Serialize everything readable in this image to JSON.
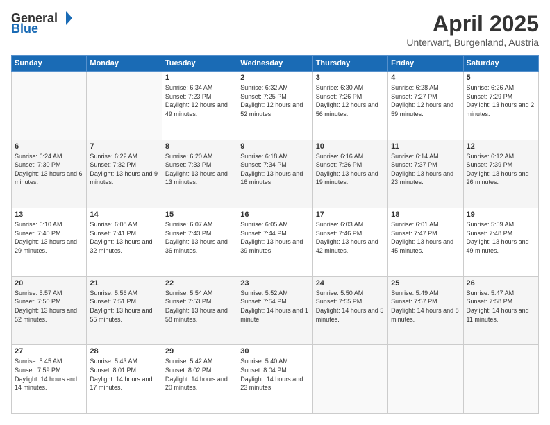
{
  "header": {
    "logo_general": "General",
    "logo_blue": "Blue",
    "month": "April 2025",
    "location": "Unterwart, Burgenland, Austria"
  },
  "days_of_week": [
    "Sunday",
    "Monday",
    "Tuesday",
    "Wednesday",
    "Thursday",
    "Friday",
    "Saturday"
  ],
  "weeks": [
    [
      {
        "day": "",
        "empty": true
      },
      {
        "day": "",
        "empty": true
      },
      {
        "day": "1",
        "sunrise": "Sunrise: 6:34 AM",
        "sunset": "Sunset: 7:23 PM",
        "daylight": "Daylight: 12 hours and 49 minutes."
      },
      {
        "day": "2",
        "sunrise": "Sunrise: 6:32 AM",
        "sunset": "Sunset: 7:25 PM",
        "daylight": "Daylight: 12 hours and 52 minutes."
      },
      {
        "day": "3",
        "sunrise": "Sunrise: 6:30 AM",
        "sunset": "Sunset: 7:26 PM",
        "daylight": "Daylight: 12 hours and 56 minutes."
      },
      {
        "day": "4",
        "sunrise": "Sunrise: 6:28 AM",
        "sunset": "Sunset: 7:27 PM",
        "daylight": "Daylight: 12 hours and 59 minutes."
      },
      {
        "day": "5",
        "sunrise": "Sunrise: 6:26 AM",
        "sunset": "Sunset: 7:29 PM",
        "daylight": "Daylight: 13 hours and 2 minutes."
      }
    ],
    [
      {
        "day": "6",
        "sunrise": "Sunrise: 6:24 AM",
        "sunset": "Sunset: 7:30 PM",
        "daylight": "Daylight: 13 hours and 6 minutes."
      },
      {
        "day": "7",
        "sunrise": "Sunrise: 6:22 AM",
        "sunset": "Sunset: 7:32 PM",
        "daylight": "Daylight: 13 hours and 9 minutes."
      },
      {
        "day": "8",
        "sunrise": "Sunrise: 6:20 AM",
        "sunset": "Sunset: 7:33 PM",
        "daylight": "Daylight: 13 hours and 13 minutes."
      },
      {
        "day": "9",
        "sunrise": "Sunrise: 6:18 AM",
        "sunset": "Sunset: 7:34 PM",
        "daylight": "Daylight: 13 hours and 16 minutes."
      },
      {
        "day": "10",
        "sunrise": "Sunrise: 6:16 AM",
        "sunset": "Sunset: 7:36 PM",
        "daylight": "Daylight: 13 hours and 19 minutes."
      },
      {
        "day": "11",
        "sunrise": "Sunrise: 6:14 AM",
        "sunset": "Sunset: 7:37 PM",
        "daylight": "Daylight: 13 hours and 23 minutes."
      },
      {
        "day": "12",
        "sunrise": "Sunrise: 6:12 AM",
        "sunset": "Sunset: 7:39 PM",
        "daylight": "Daylight: 13 hours and 26 minutes."
      }
    ],
    [
      {
        "day": "13",
        "sunrise": "Sunrise: 6:10 AM",
        "sunset": "Sunset: 7:40 PM",
        "daylight": "Daylight: 13 hours and 29 minutes."
      },
      {
        "day": "14",
        "sunrise": "Sunrise: 6:08 AM",
        "sunset": "Sunset: 7:41 PM",
        "daylight": "Daylight: 13 hours and 32 minutes."
      },
      {
        "day": "15",
        "sunrise": "Sunrise: 6:07 AM",
        "sunset": "Sunset: 7:43 PM",
        "daylight": "Daylight: 13 hours and 36 minutes."
      },
      {
        "day": "16",
        "sunrise": "Sunrise: 6:05 AM",
        "sunset": "Sunset: 7:44 PM",
        "daylight": "Daylight: 13 hours and 39 minutes."
      },
      {
        "day": "17",
        "sunrise": "Sunrise: 6:03 AM",
        "sunset": "Sunset: 7:46 PM",
        "daylight": "Daylight: 13 hours and 42 minutes."
      },
      {
        "day": "18",
        "sunrise": "Sunrise: 6:01 AM",
        "sunset": "Sunset: 7:47 PM",
        "daylight": "Daylight: 13 hours and 45 minutes."
      },
      {
        "day": "19",
        "sunrise": "Sunrise: 5:59 AM",
        "sunset": "Sunset: 7:48 PM",
        "daylight": "Daylight: 13 hours and 49 minutes."
      }
    ],
    [
      {
        "day": "20",
        "sunrise": "Sunrise: 5:57 AM",
        "sunset": "Sunset: 7:50 PM",
        "daylight": "Daylight: 13 hours and 52 minutes."
      },
      {
        "day": "21",
        "sunrise": "Sunrise: 5:56 AM",
        "sunset": "Sunset: 7:51 PM",
        "daylight": "Daylight: 13 hours and 55 minutes."
      },
      {
        "day": "22",
        "sunrise": "Sunrise: 5:54 AM",
        "sunset": "Sunset: 7:53 PM",
        "daylight": "Daylight: 13 hours and 58 minutes."
      },
      {
        "day": "23",
        "sunrise": "Sunrise: 5:52 AM",
        "sunset": "Sunset: 7:54 PM",
        "daylight": "Daylight: 14 hours and 1 minute."
      },
      {
        "day": "24",
        "sunrise": "Sunrise: 5:50 AM",
        "sunset": "Sunset: 7:55 PM",
        "daylight": "Daylight: 14 hours and 5 minutes."
      },
      {
        "day": "25",
        "sunrise": "Sunrise: 5:49 AM",
        "sunset": "Sunset: 7:57 PM",
        "daylight": "Daylight: 14 hours and 8 minutes."
      },
      {
        "day": "26",
        "sunrise": "Sunrise: 5:47 AM",
        "sunset": "Sunset: 7:58 PM",
        "daylight": "Daylight: 14 hours and 11 minutes."
      }
    ],
    [
      {
        "day": "27",
        "sunrise": "Sunrise: 5:45 AM",
        "sunset": "Sunset: 7:59 PM",
        "daylight": "Daylight: 14 hours and 14 minutes."
      },
      {
        "day": "28",
        "sunrise": "Sunrise: 5:43 AM",
        "sunset": "Sunset: 8:01 PM",
        "daylight": "Daylight: 14 hours and 17 minutes."
      },
      {
        "day": "29",
        "sunrise": "Sunrise: 5:42 AM",
        "sunset": "Sunset: 8:02 PM",
        "daylight": "Daylight: 14 hours and 20 minutes."
      },
      {
        "day": "30",
        "sunrise": "Sunrise: 5:40 AM",
        "sunset": "Sunset: 8:04 PM",
        "daylight": "Daylight: 14 hours and 23 minutes."
      },
      {
        "day": "",
        "empty": true
      },
      {
        "day": "",
        "empty": true
      },
      {
        "day": "",
        "empty": true
      }
    ]
  ]
}
